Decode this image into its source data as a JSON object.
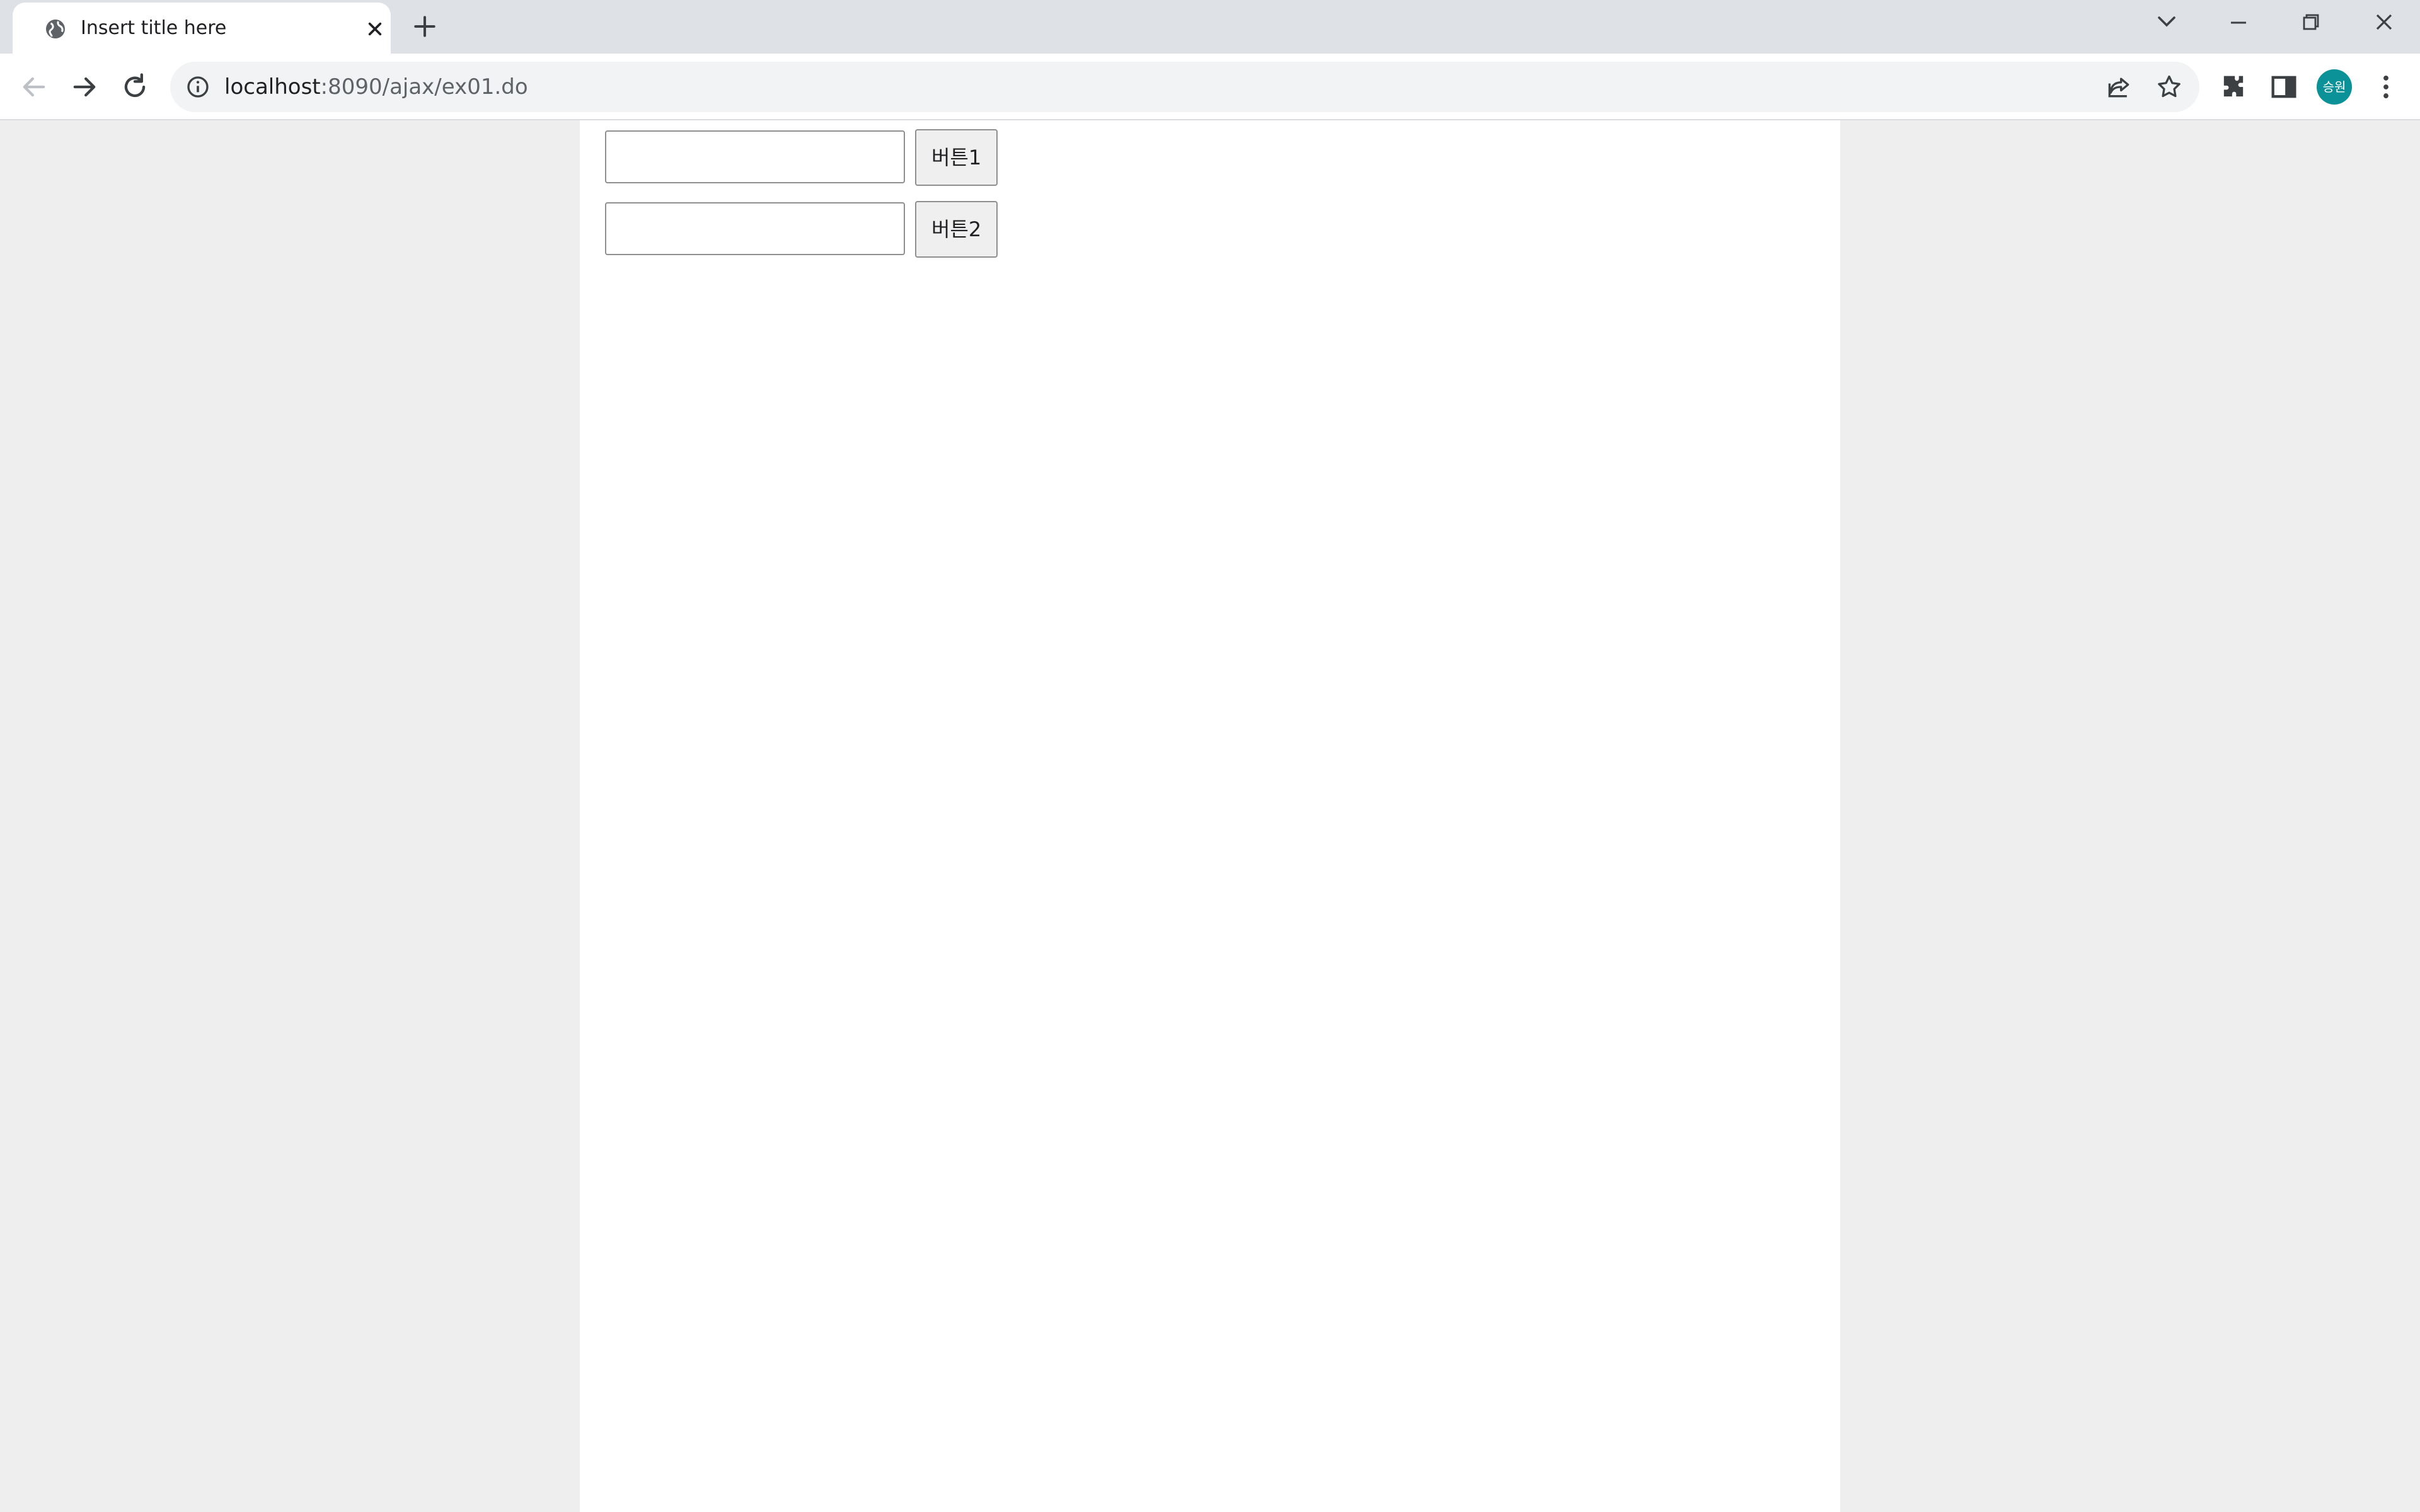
{
  "browser": {
    "tab_title": "Insert title here",
    "url_host": "localhost",
    "url_rest": ":8090/ajax/ex01.do",
    "profile_initials": "승원",
    "profile_color": "#0b9198"
  },
  "page": {
    "input1": {
      "value": "",
      "placeholder": ""
    },
    "button1_label": "버튼1",
    "input2": {
      "value": "",
      "placeholder": ""
    },
    "button2_label": "버튼2"
  }
}
